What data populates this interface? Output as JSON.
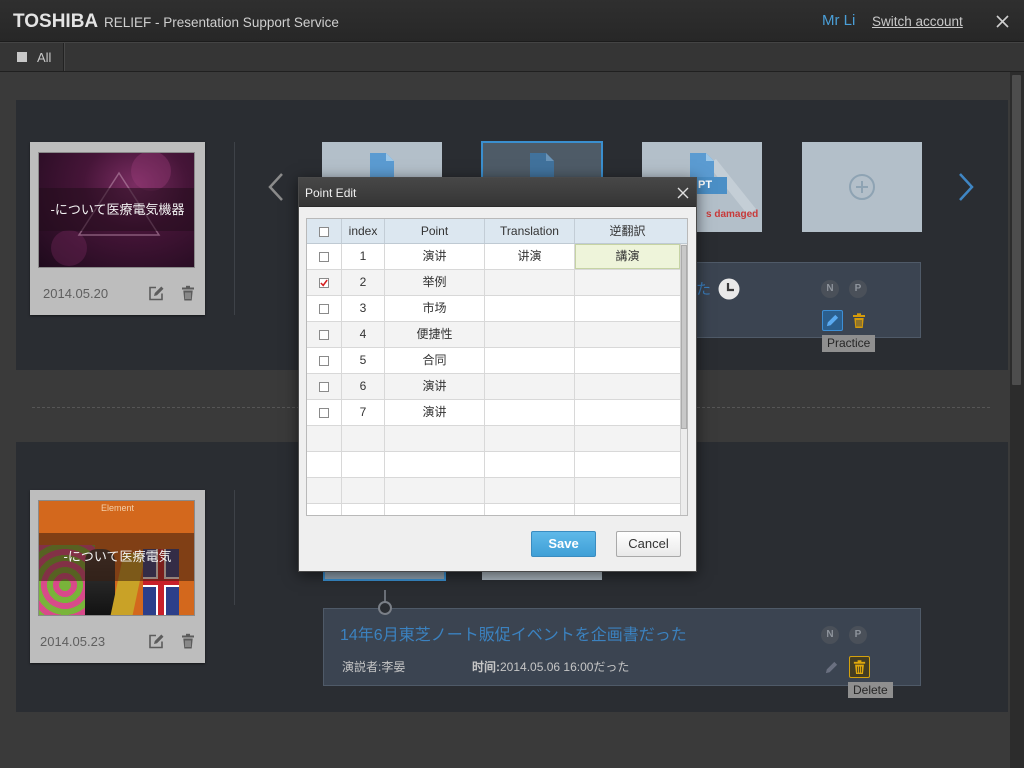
{
  "app": {
    "brand": "TOSHIBA",
    "title": "RELIEF - Presentation Support Service",
    "user": "Mr Li",
    "switch_account": "Switch account",
    "close_icon": "close-icon"
  },
  "toolbar": {
    "filter_icon": "square-icon",
    "filter_label": "All"
  },
  "presentations": [
    {
      "thumbnail_caption": "-について医療電気機器",
      "date": "2014.05.20",
      "card_icons": [
        "edit-icon",
        "trash-icon"
      ],
      "slides": [
        {
          "icon": "file-icon"
        },
        {
          "icon": "file-icon",
          "selected": true
        },
        {
          "icon": "file-icon",
          "badge": "PT",
          "error": "s damaged"
        },
        {
          "icon": "plus-icon"
        }
      ],
      "info": {
        "title": "た",
        "status_icon": "clock-icon",
        "badges": [
          "N",
          "P"
        ],
        "tooltip": "Practice"
      }
    },
    {
      "thumbnail_header": "Element",
      "thumbnail_caption": "-について医療電気",
      "date": "2014.05.23",
      "card_icons": [
        "edit-icon",
        "trash-icon"
      ],
      "slides": [
        {
          "selected": true
        },
        {}
      ],
      "info": {
        "title": "14年6月東芝ノート販促イベントを企画書だった",
        "presenter": "演説者:李晏",
        "time_label": "时间:",
        "time": "2014.05.06 16:00だった",
        "badges": [
          "N",
          "P"
        ],
        "tooltip": "Delete"
      }
    }
  ],
  "dialog": {
    "title": "Point Edit",
    "columns": {
      "index": "index",
      "point": "Point",
      "translation": "Translation",
      "back_translation": "逆翻訳"
    },
    "rows": [
      {
        "index": 1,
        "point": "演讲",
        "translation": "讲演",
        "back_translation": "講演",
        "checked": false,
        "editing": true
      },
      {
        "index": 2,
        "point": "举例",
        "translation": "",
        "back_translation": "",
        "checked": true
      },
      {
        "index": 3,
        "point": "市场",
        "translation": "",
        "back_translation": "",
        "checked": false
      },
      {
        "index": 4,
        "point": "便捷性",
        "translation": "",
        "back_translation": "",
        "checked": false
      },
      {
        "index": 5,
        "point": "合同",
        "translation": "",
        "back_translation": "",
        "checked": false
      },
      {
        "index": 6,
        "point": "演讲",
        "translation": "",
        "back_translation": "",
        "checked": false
      },
      {
        "index": 7,
        "point": "演讲",
        "translation": "",
        "back_translation": "",
        "checked": false
      }
    ],
    "save": "Save",
    "cancel": "Cancel"
  },
  "colors": {
    "accent": "#4a9fd8",
    "link": "#3b82c0",
    "save_button": "#4aa8dc",
    "error": "#c83a3a",
    "delete_highlight": "#d4a10d"
  }
}
